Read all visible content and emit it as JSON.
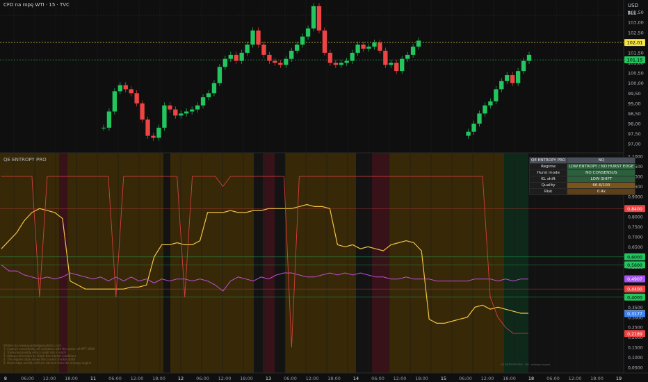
{
  "header": {
    "symbol_title": "CFD na ropę WTI · 15 · TVC",
    "currency": "USD",
    "bll_label": "BLL"
  },
  "indicator": {
    "title": "QE ENTROPY PRO",
    "table": {
      "header_left": "QE ENTROPY PRO",
      "header_right": "NQ",
      "rows": [
        {
          "label": "Regime",
          "value": "LOW ENTROPY / NO HURST EDGE"
        },
        {
          "label": "Hurst mode",
          "value": "NO CONSENSUS"
        },
        {
          "label": "KL shift",
          "value": "LOW SHIFT"
        },
        {
          "label": "Quality",
          "value": "66.6/100"
        },
        {
          "label": "Risk",
          "value": "0.4x"
        }
      ]
    },
    "notes": [
      "Written by: www.quantedgeanalytics.com",
      "1. Capture consistently all indicators with the option of MTF VIEW",
      "2. Trade responsibly only a small risk in each",
      "3. Always remember to check the market conditions",
      "4. The regime table shows the current market state",
      "5. Hurst edge and KL shift are derived from the entropy engine"
    ],
    "footer": "QE ENTROPY PRO · NQ · entropy engine"
  },
  "price_axis": {
    "labels": [
      "103,50",
      "103,00",
      "102,50",
      "102,00",
      "101,50",
      "101,00",
      "100,50",
      "100,00",
      "99,50",
      "99,00",
      "98,50",
      "98,00",
      "97,50",
      "97,00"
    ],
    "badges": [
      {
        "text": "102,01",
        "color": "#f5e342",
        "fg": "#000000",
        "value": 102.01
      },
      {
        "text": "101,15",
        "color": "#22c55e",
        "fg": "#000000",
        "value": 101.15
      }
    ]
  },
  "ind_axis": {
    "labels": [
      "1,1000",
      "1,0500",
      "1,0000",
      "0,9500",
      "0,9000",
      "0,8500",
      "0,8000",
      "0,7500",
      "0,7000",
      "0,6500",
      "0,6000",
      "0,5500",
      "0,5000",
      "0,4500",
      "0,4000",
      "0,3500",
      "0,3000",
      "0,2500",
      "0,2000",
      "0,1500",
      "0,1000",
      "0,0500"
    ],
    "badges": [
      {
        "text": "0,8400",
        "color": "#ef4444",
        "fg": "#ffffff",
        "value": 0.84
      },
      {
        "text": "0,6000",
        "color": "#22c55e",
        "fg": "#000000",
        "value": 0.6
      },
      {
        "text": "0,5600",
        "color": "#22c55e",
        "fg": "#000000",
        "value": 0.56
      },
      {
        "text": "0,4907",
        "color": "#a855f7",
        "fg": "#ffffff",
        "value": 0.4907
      },
      {
        "text": "0,4400",
        "color": "#ef4444",
        "fg": "#ffffff",
        "value": 0.44
      },
      {
        "text": "0,4000",
        "color": "#22c55e",
        "fg": "#000000",
        "value": 0.4
      },
      {
        "text": "0,3192",
        "color": "#f59e0b",
        "fg": "#000000",
        "value": 0.3192
      },
      {
        "text": "0,3177",
        "color": "#3b82f6",
        "fg": "#ffffff",
        "value": 0.3177
      },
      {
        "text": "0,2189",
        "color": "#ef4444",
        "fg": "#ffffff",
        "value": 0.2189
      }
    ]
  },
  "time_axis": [
    "8",
    "06:00",
    "12:00",
    "18:00",
    "11",
    "06:00",
    "12:00",
    "18:00",
    "12",
    "06:00",
    "12:00",
    "18:00",
    "13",
    "06:00",
    "12:00",
    "18:00",
    "14",
    "06:00",
    "12:00",
    "18:00",
    "15",
    "06:00",
    "12:00",
    "18:00",
    "18",
    "06:00",
    "12:00",
    "18:00",
    "19"
  ],
  "colors": {
    "up": "#22c55e",
    "down": "#ef4444",
    "entropy": "#f5c542",
    "hurst": "#c44fd6",
    "regime": "#ef4444",
    "band_orange": "#3a2a08",
    "band_red": "#3a141a",
    "band_green": "#0f2a1a",
    "band_dark": "#141414"
  },
  "chart_data": [
    {
      "type": "candlestick",
      "title": "CFD na ropę WTI · 15 · TVC",
      "ylim": [
        96.8,
        103.9
      ],
      "series": [
        {
          "values": [
            97.8,
            98.6,
            99.6,
            99.9,
            99.7,
            99.5,
            99.0,
            98.2,
            97.4,
            97.3,
            97.8,
            98.9,
            98.7,
            98.4,
            98.5,
            98.6,
            98.7,
            98.9,
            99.3,
            99.5,
            100.0,
            100.8,
            101.2,
            101.4,
            101.1,
            101.5,
            101.9,
            102.6,
            101.9,
            101.4,
            101.1,
            101.0,
            100.9,
            101.2,
            101.6,
            101.9,
            102.3,
            102.7,
            103.8,
            102.6,
            101.5,
            101.0,
            100.9,
            101.0,
            101.1,
            101.5,
            101.9,
            101.7,
            101.8,
            102.0,
            101.6,
            100.9,
            101.0,
            100.6,
            101.2,
            101.4,
            101.8,
            102.1,
            null,
            null,
            null,
            null,
            null,
            null,
            null,
            null,
            97.6,
            98.0,
            98.5,
            98.9,
            99.1,
            99.7,
            100.1,
            100.4,
            100.0,
            100.6,
            101.1,
            101.4
          ]
        }
      ]
    },
    {
      "type": "line",
      "title": "QE ENTROPY PRO",
      "ylim": [
        0.03,
        1.11
      ],
      "series": [
        {
          "values": [
            0.64,
            0.68,
            0.72,
            0.78,
            0.82,
            0.84,
            0.83,
            0.82,
            0.79,
            0.48,
            0.46,
            0.44,
            0.44,
            0.44,
            0.44,
            0.44,
            0.44,
            0.45,
            0.45,
            0.46,
            0.6,
            0.66,
            0.66,
            0.67,
            0.66,
            0.66,
            0.68,
            0.82,
            0.82,
            0.82,
            0.83,
            0.82,
            0.82,
            0.83,
            0.83,
            0.84,
            0.84,
            0.84,
            0.84,
            0.85,
            0.86,
            0.85,
            0.85,
            0.84,
            0.66,
            0.65,
            0.66,
            0.64,
            0.65,
            0.64,
            0.63,
            0.66,
            0.67,
            0.68,
            0.67,
            0.63,
            0.29,
            0.27,
            0.27,
            0.28,
            0.29,
            0.3,
            0.35,
            0.36,
            0.34,
            0.35,
            0.34,
            0.33,
            0.32,
            0.32
          ]
        },
        {
          "values": [
            0.56,
            0.53,
            0.53,
            0.51,
            0.5,
            0.49,
            0.5,
            0.49,
            0.5,
            0.52,
            0.51,
            0.5,
            0.49,
            0.5,
            0.48,
            0.5,
            0.48,
            0.5,
            0.48,
            0.49,
            0.47,
            0.49,
            0.48,
            0.49,
            0.49,
            0.48,
            0.49,
            0.48,
            0.46,
            0.43,
            0.48,
            0.5,
            0.49,
            0.48,
            0.5,
            0.49,
            0.51,
            0.52,
            0.52,
            0.51,
            0.5,
            0.5,
            0.51,
            0.52,
            0.51,
            0.52,
            0.51,
            0.52,
            0.51,
            0.5,
            0.5,
            0.49,
            0.49,
            0.5,
            0.49,
            0.49,
            0.49,
            0.48,
            0.48,
            0.48,
            0.48,
            0.48,
            0.49,
            0.49,
            0.49,
            0.48,
            0.49,
            0.48,
            0.49,
            0.49
          ]
        },
        {
          "values": [
            1.0,
            1.0,
            1.0,
            1.0,
            1.0,
            0.4,
            1.0,
            1.0,
            1.0,
            1.0,
            1.0,
            1.0,
            1.0,
            1.0,
            1.0,
            0.4,
            1.0,
            1.0,
            1.0,
            1.0,
            1.0,
            1.0,
            1.0,
            1.0,
            0.4,
            1.0,
            1.0,
            1.0,
            1.0,
            0.95,
            1.0,
            1.0,
            1.0,
            1.0,
            1.0,
            1.0,
            1.0,
            1.0,
            0.15,
            1.0,
            1.0,
            1.0,
            1.0,
            1.0,
            1.0,
            1.0,
            1.0,
            1.0,
            1.0,
            1.0,
            1.0,
            1.0,
            1.0,
            1.0,
            1.0,
            1.0,
            1.0,
            1.0,
            1.0,
            1.0,
            1.0,
            1.0,
            1.0,
            1.0,
            0.4,
            0.3,
            0.25,
            0.22,
            0.22,
            0.22
          ]
        }
      ]
    }
  ]
}
